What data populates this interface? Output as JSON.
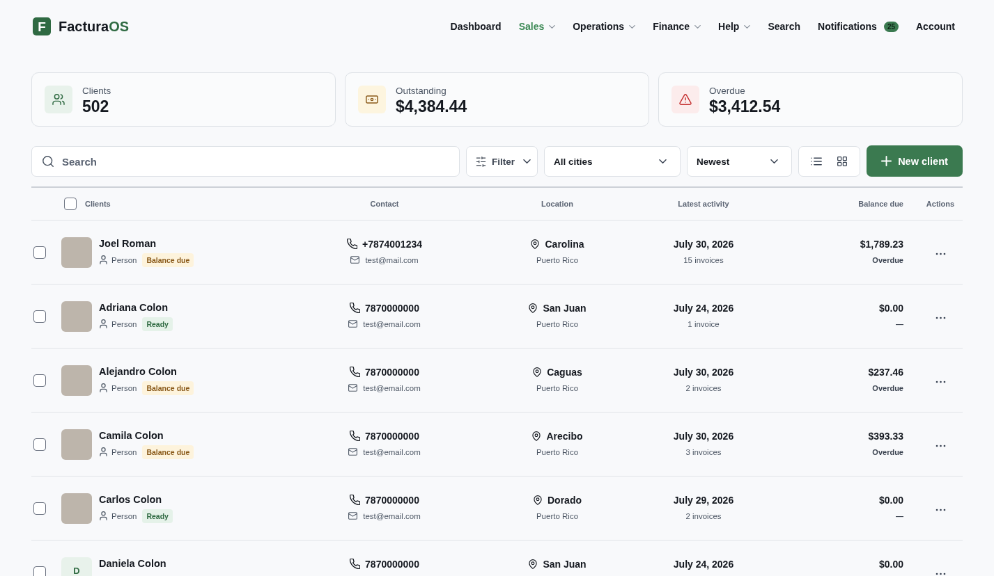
{
  "brand": {
    "mark": "F",
    "name": "Factura",
    "suffix": "OS"
  },
  "nav": [
    {
      "label": "Dashboard",
      "selected": false,
      "has_menu": false
    },
    {
      "label": "Sales",
      "selected": true,
      "has_menu": true
    },
    {
      "label": "Operations",
      "selected": false,
      "has_menu": true
    },
    {
      "label": "Finance",
      "selected": false,
      "has_menu": true
    },
    {
      "label": "Help",
      "selected": false,
      "has_menu": true
    },
    {
      "label": "Search",
      "selected": false,
      "has_menu": false
    },
    {
      "label": "Notifications",
      "selected": false,
      "has_menu": false,
      "badge": "25"
    },
    {
      "label": "Account",
      "selected": false,
      "has_menu": false
    }
  ],
  "stats": [
    {
      "kind": "clients",
      "label": "Clients",
      "value": "502"
    },
    {
      "kind": "outstanding",
      "label": "Outstanding",
      "value": "$4,384.44"
    },
    {
      "kind": "overdue",
      "label": "Overdue",
      "value": "$3,412.54"
    }
  ],
  "toolbar": {
    "search": {
      "placeholder": "Search"
    },
    "filter": {
      "label": "Filter"
    },
    "city_select": {
      "value": "All cities"
    },
    "sort_select": {
      "value": "Newest"
    },
    "view_options": [
      {
        "kind": "list",
        "selected": false
      },
      {
        "kind": "grid",
        "selected": false
      }
    ],
    "new_button": {
      "label": "New client"
    }
  },
  "table": {
    "select_all": {
      "checked": false
    },
    "columns": [
      "Clients",
      "Contact",
      "Location",
      "Latest activity",
      "Balance due",
      "Actions"
    ],
    "rows": [
      {
        "checked": false,
        "avatar": {
          "kind": "photo"
        },
        "name": "Joel Roman",
        "type": "Person",
        "status": {
          "kind": "warning",
          "label": "Balance due"
        },
        "phone": "+7874001234",
        "email": "test@mail.com",
        "city": "Carolina",
        "country": "Puerto Rico",
        "date": "July 30, 2026",
        "invoices": "15 invoices",
        "balance": "$1,789.23",
        "balance_note": "Overdue"
      },
      {
        "checked": false,
        "avatar": {
          "kind": "photo"
        },
        "name": "Adriana Colon",
        "type": "Person",
        "status": {
          "kind": "success",
          "label": "Ready"
        },
        "phone": "7870000000",
        "email": "test@email.com",
        "city": "San Juan",
        "country": "Puerto Rico",
        "date": "July 24, 2026",
        "invoices": "1 invoice",
        "balance": "$0.00",
        "balance_note": "—"
      },
      {
        "checked": false,
        "avatar": {
          "kind": "photo"
        },
        "name": "Alejandro Colon",
        "type": "Person",
        "status": {
          "kind": "warning",
          "label": "Balance due"
        },
        "phone": "7870000000",
        "email": "test@email.com",
        "city": "Caguas",
        "country": "Puerto Rico",
        "date": "July 30, 2026",
        "invoices": "2 invoices",
        "balance": "$237.46",
        "balance_note": "Overdue"
      },
      {
        "checked": false,
        "avatar": {
          "kind": "photo"
        },
        "name": "Camila Colon",
        "type": "Person",
        "status": {
          "kind": "warning",
          "label": "Balance due"
        },
        "phone": "7870000000",
        "email": "test@email.com",
        "city": "Arecibo",
        "country": "Puerto Rico",
        "date": "July 30, 2026",
        "invoices": "3 invoices",
        "balance": "$393.33",
        "balance_note": "Overdue"
      },
      {
        "checked": false,
        "avatar": {
          "kind": "photo"
        },
        "name": "Carlos Colon",
        "type": "Person",
        "status": {
          "kind": "success",
          "label": "Ready"
        },
        "phone": "7870000000",
        "email": "test@email.com",
        "city": "Dorado",
        "country": "Puerto Rico",
        "date": "July 29, 2026",
        "invoices": "2 invoices",
        "balance": "$0.00",
        "balance_note": "—"
      },
      {
        "checked": false,
        "avatar": {
          "kind": "initial",
          "text": "D"
        },
        "name": "Daniela Colon",
        "phone": "7870000000",
        "city": "San Juan",
        "date": "July 24, 2026",
        "balance": "$0.00"
      }
    ]
  }
}
